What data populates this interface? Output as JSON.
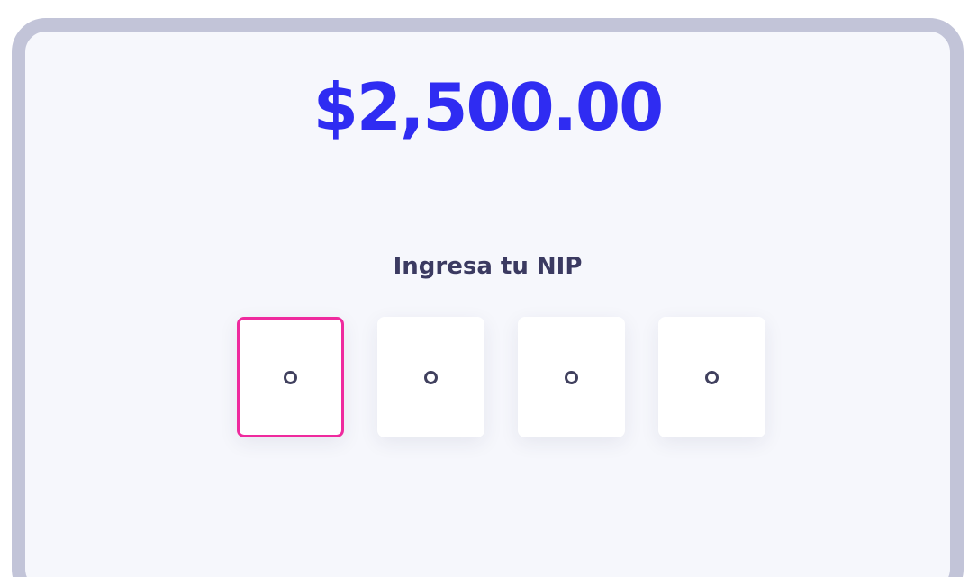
{
  "amount": {
    "value": "$2,500.00"
  },
  "pin": {
    "label": "Ingresa tu NIP",
    "digits": 4,
    "active_index": 0
  },
  "colors": {
    "amount": "#2f2cf2",
    "active_border": "#ef2a9e",
    "card_border": "#c2c4d8",
    "card_background": "#f6f7fc"
  },
  "icons": {
    "pin_placeholder": "empty-circle-icon"
  }
}
